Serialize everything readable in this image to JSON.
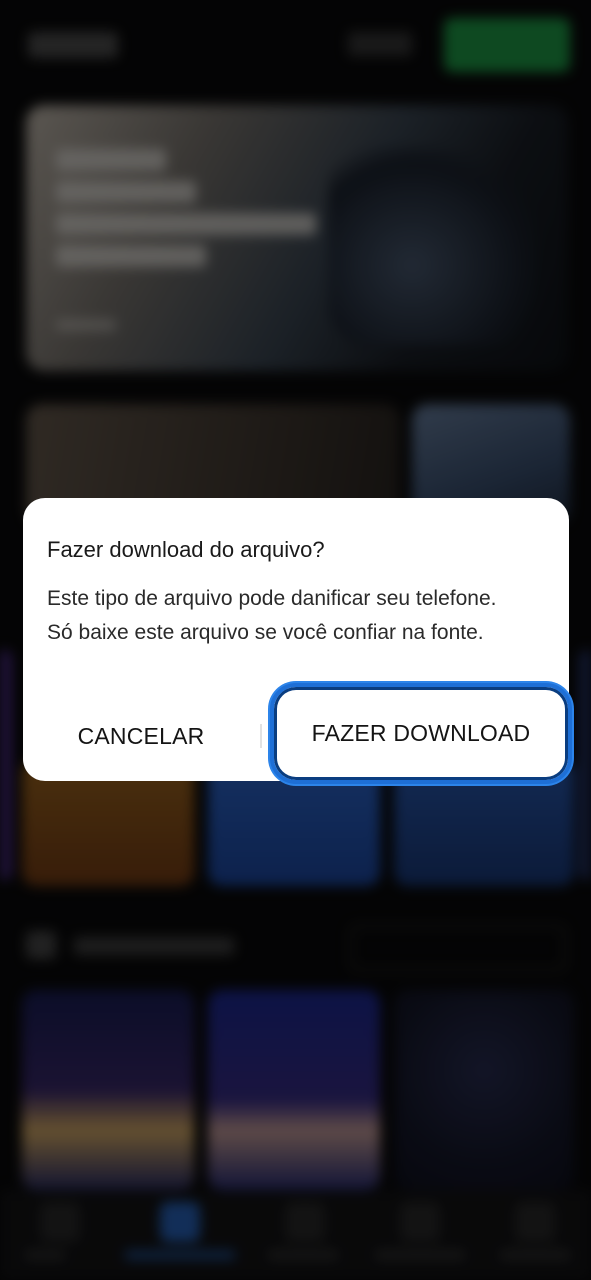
{
  "dialog": {
    "title": "Fazer download do arquivo?",
    "message": "Este tipo de arquivo pode danificar seu telefone. Só baixe este arquivo se você confiar na fonte.",
    "cancel_label": "CANCELAR",
    "download_label": "FAZER DOWNLOAD"
  },
  "colors": {
    "dialog_bg": "#ffffff",
    "highlight": "#1e6fd6",
    "background": "#0b0b0c",
    "register_green": "#1fa34a"
  }
}
